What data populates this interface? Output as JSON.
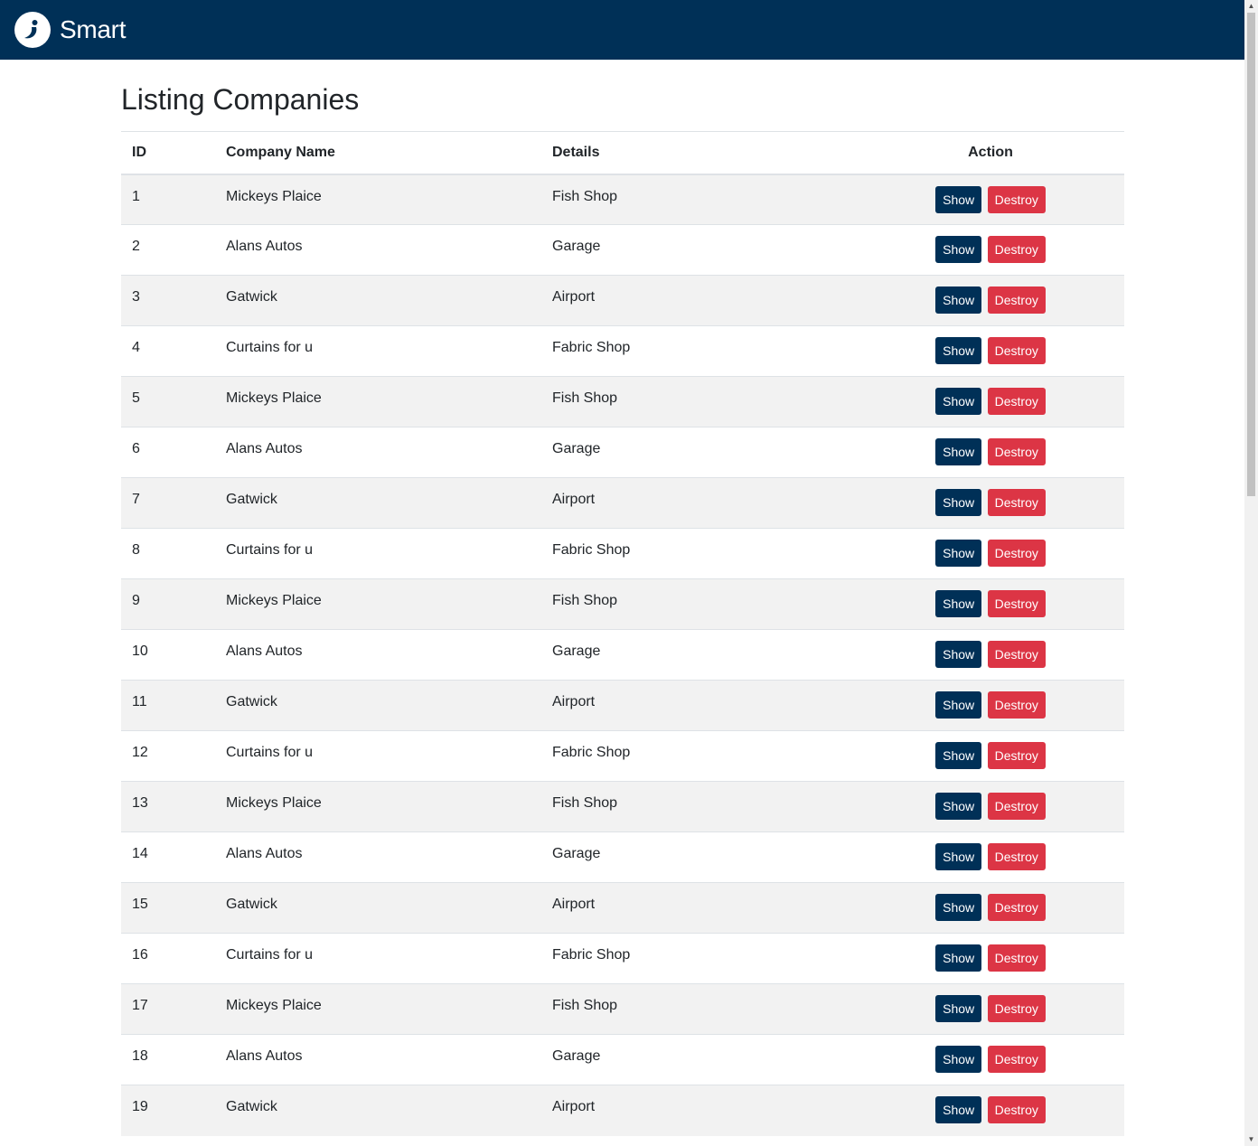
{
  "app": {
    "brand": "Smart",
    "logo_icon": "smart-logo-icon"
  },
  "colors": {
    "navbar": "#003057",
    "show_button": "#003057",
    "destroy_button": "#dc3545",
    "stripe": "#f2f2f2"
  },
  "page": {
    "title": "Listing Companies"
  },
  "table": {
    "headers": {
      "id": "ID",
      "name": "Company Name",
      "details": "Details",
      "action": "Action"
    },
    "show_label": "Show",
    "destroy_label": "Destroy",
    "rows": [
      {
        "id": "1",
        "name": "Mickeys Plaice",
        "details": "Fish Shop"
      },
      {
        "id": "2",
        "name": "Alans Autos",
        "details": "Garage"
      },
      {
        "id": "3",
        "name": "Gatwick",
        "details": "Airport"
      },
      {
        "id": "4",
        "name": "Curtains for u",
        "details": "Fabric Shop"
      },
      {
        "id": "5",
        "name": "Mickeys Plaice",
        "details": "Fish Shop"
      },
      {
        "id": "6",
        "name": "Alans Autos",
        "details": "Garage"
      },
      {
        "id": "7",
        "name": "Gatwick",
        "details": "Airport"
      },
      {
        "id": "8",
        "name": "Curtains for u",
        "details": "Fabric Shop"
      },
      {
        "id": "9",
        "name": "Mickeys Plaice",
        "details": "Fish Shop"
      },
      {
        "id": "10",
        "name": "Alans Autos",
        "details": "Garage"
      },
      {
        "id": "11",
        "name": "Gatwick",
        "details": "Airport"
      },
      {
        "id": "12",
        "name": "Curtains for u",
        "details": "Fabric Shop"
      },
      {
        "id": "13",
        "name": "Mickeys Plaice",
        "details": "Fish Shop"
      },
      {
        "id": "14",
        "name": "Alans Autos",
        "details": "Garage"
      },
      {
        "id": "15",
        "name": "Gatwick",
        "details": "Airport"
      },
      {
        "id": "16",
        "name": "Curtains for u",
        "details": "Fabric Shop"
      },
      {
        "id": "17",
        "name": "Mickeys Plaice",
        "details": "Fish Shop"
      },
      {
        "id": "18",
        "name": "Alans Autos",
        "details": "Garage"
      },
      {
        "id": "19",
        "name": "Gatwick",
        "details": "Airport"
      }
    ]
  }
}
